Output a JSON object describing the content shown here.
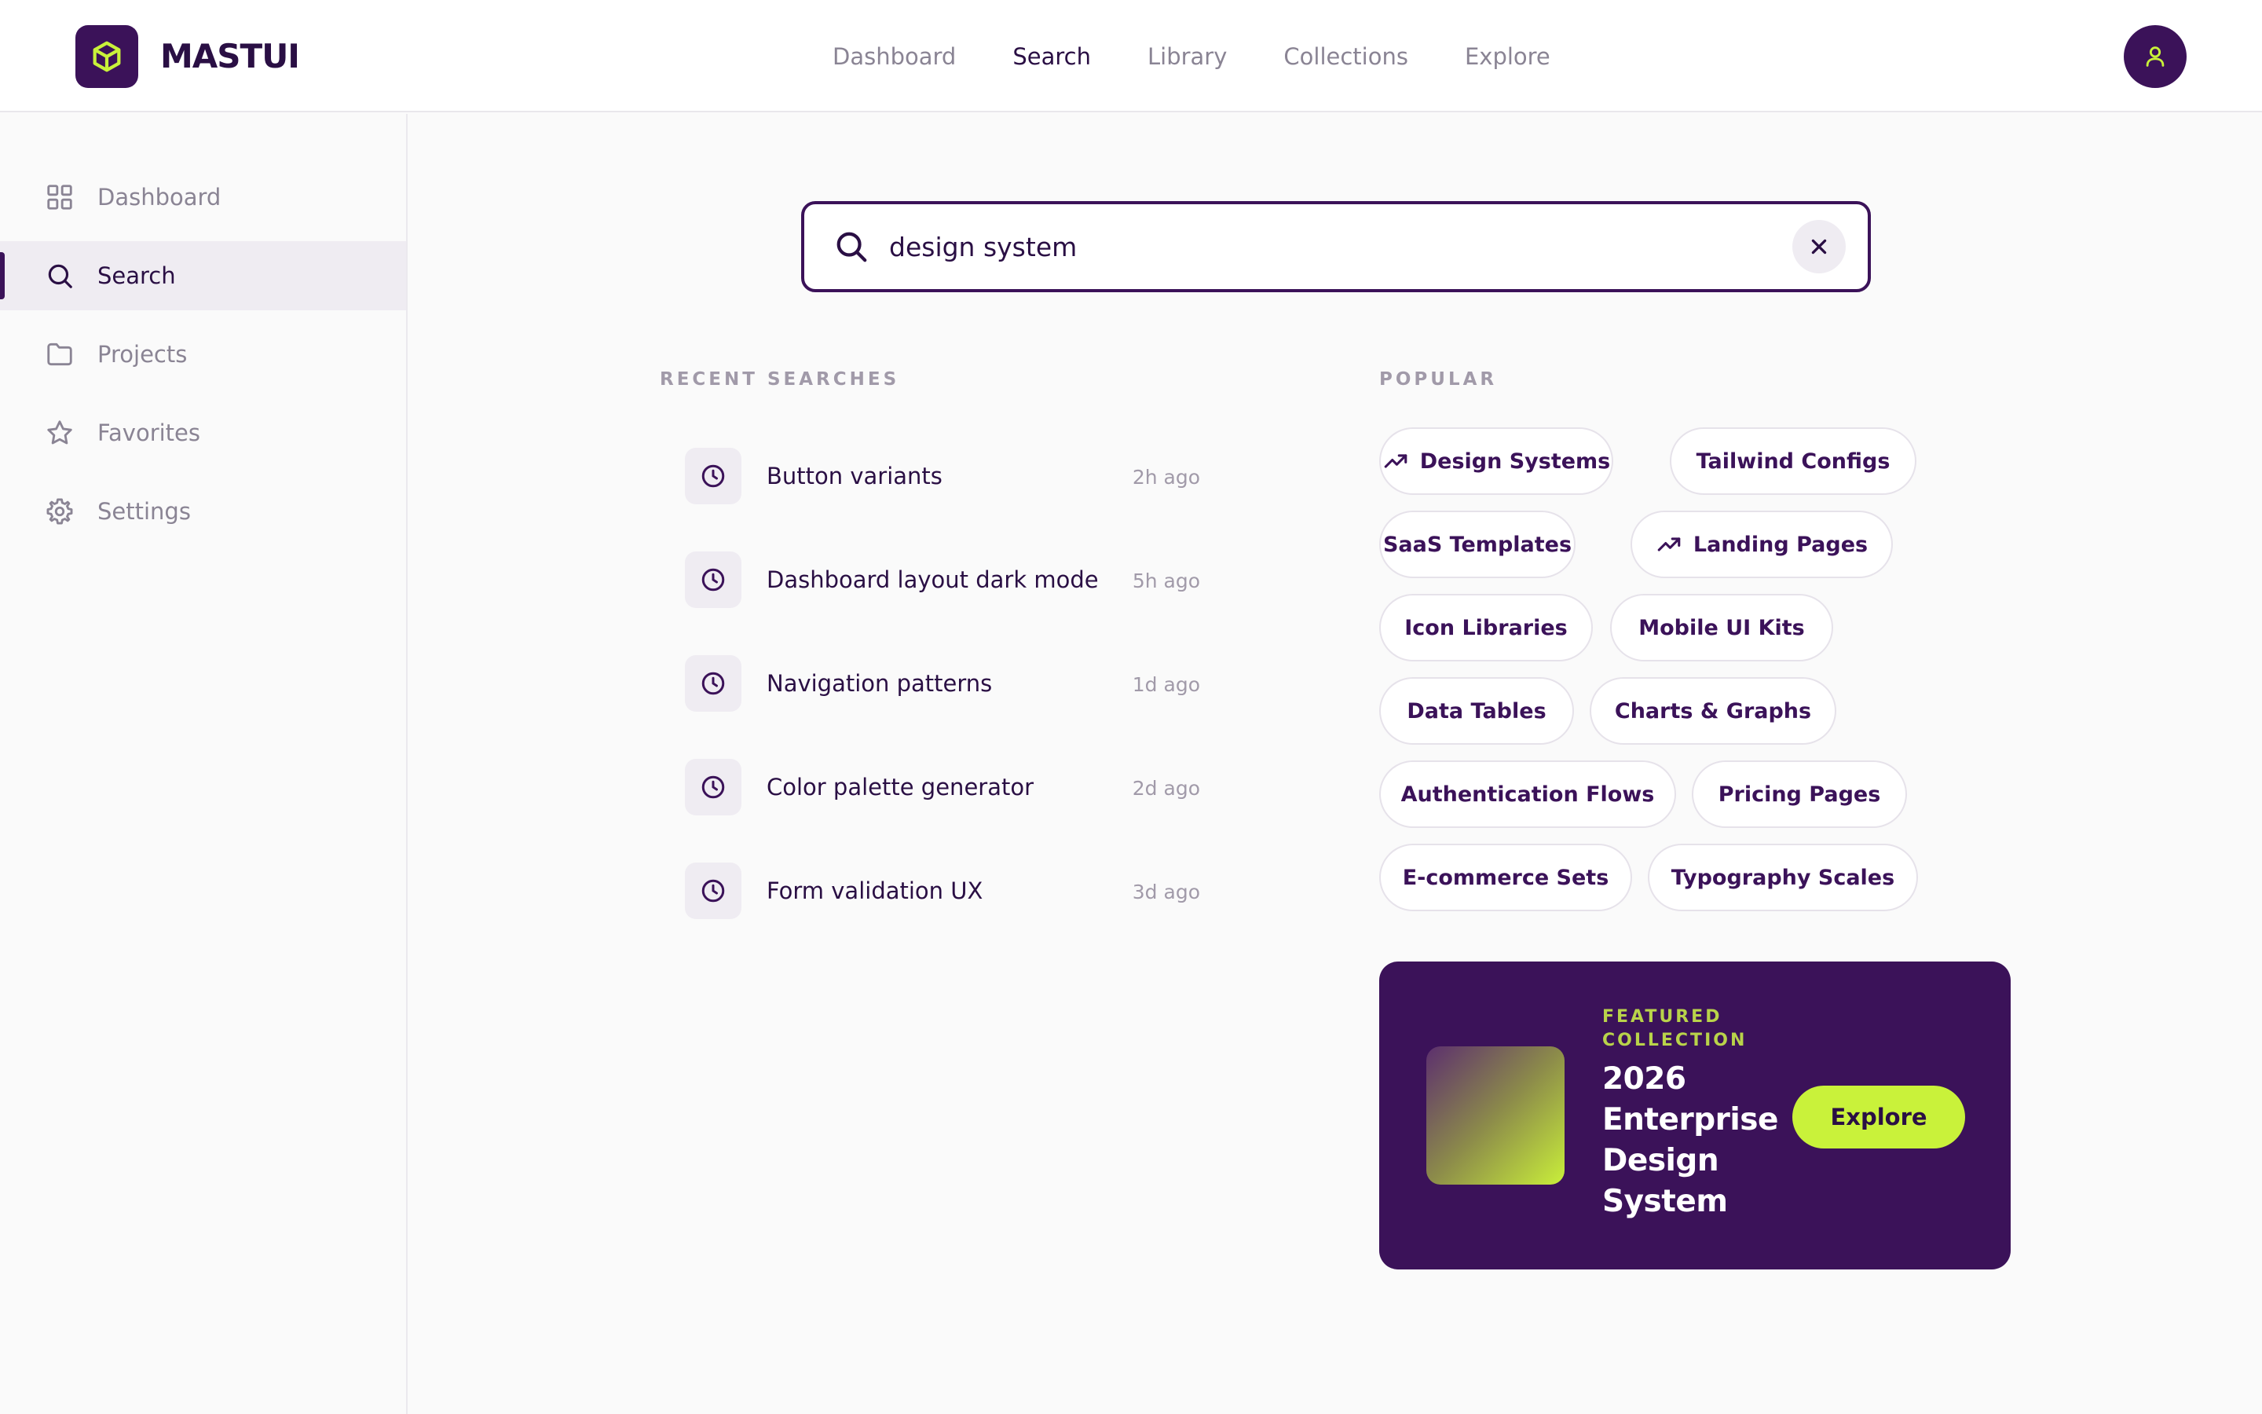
{
  "brand": {
    "name": "MASTUI"
  },
  "topnav": [
    {
      "label": "Dashboard",
      "active": false
    },
    {
      "label": "Search",
      "active": true
    },
    {
      "label": "Library",
      "active": false
    },
    {
      "label": "Collections",
      "active": false
    },
    {
      "label": "Explore",
      "active": false
    }
  ],
  "sidebar": {
    "items": [
      {
        "label": "Dashboard",
        "icon": "grid-icon",
        "active": false
      },
      {
        "label": "Search",
        "icon": "search-icon",
        "active": true
      },
      {
        "label": "Projects",
        "icon": "folder-icon",
        "active": false
      },
      {
        "label": "Favorites",
        "icon": "star-icon",
        "active": false
      },
      {
        "label": "Settings",
        "icon": "gear-icon",
        "active": false
      }
    ]
  },
  "search": {
    "value": "design system",
    "placeholder": ""
  },
  "recent": {
    "heading": "RECENT SEARCHES",
    "items": [
      {
        "label": "Button variants",
        "time": "2h ago"
      },
      {
        "label": "Dashboard layout dark mode",
        "time": "5h ago"
      },
      {
        "label": "Navigation patterns",
        "time": "1d ago"
      },
      {
        "label": "Color palette generator",
        "time": "2d ago"
      },
      {
        "label": "Form validation UX",
        "time": "3d ago"
      }
    ]
  },
  "popular": {
    "heading": "POPULAR",
    "chips": [
      {
        "label": "Design Systems",
        "trending": true
      },
      {
        "label": "Tailwind Configs",
        "trending": false
      },
      {
        "label": "SaaS Templates",
        "trending": false
      },
      {
        "label": "Landing Pages",
        "trending": true
      },
      {
        "label": "Icon Libraries",
        "trending": false
      },
      {
        "label": "Mobile UI Kits",
        "trending": false
      },
      {
        "label": "Data Tables",
        "trending": false
      },
      {
        "label": "Charts & Graphs",
        "trending": false
      },
      {
        "label": "Authentication Flows",
        "trending": false
      },
      {
        "label": "Pricing Pages",
        "trending": false
      },
      {
        "label": "E-commerce Sets",
        "trending": false
      },
      {
        "label": "Typography Scales",
        "trending": false
      }
    ]
  },
  "featured": {
    "kicker": "FEATURED COLLECTION",
    "title": "2026 Enterprise Design System",
    "button": "Explore"
  },
  "colors": {
    "brand": "#3b1259",
    "accent": "#c9f23a",
    "text": "#2a0f44",
    "muted": "#8a8494"
  }
}
